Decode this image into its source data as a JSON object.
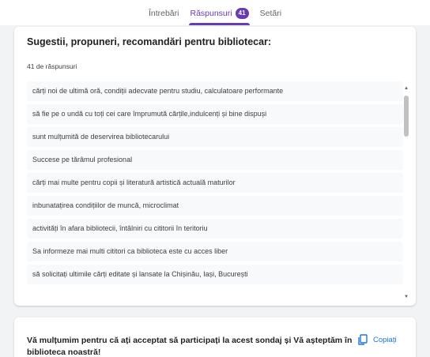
{
  "tabs": [
    {
      "label": "Întrebări"
    },
    {
      "label": "Răspunsuri",
      "badge": "41"
    },
    {
      "label": "Setări"
    }
  ],
  "question": {
    "title": "Sugestii, propuneri, recomandări pentru bibliotecar:",
    "count_label": "41 de răspunsuri",
    "answers": [
      "cărți noi de ultimă oră, condiții adecvate pentru studiu, calculatoare performante",
      "să fie pe o undă cu toți cei care împrumută cărțile,indulcenți și bine dispuși",
      "sunt mulțumită de deservirea bibliotecarului",
      "Succese pe tărâmul profesional",
      "cărți mai multe pentru copii și literatură artistică actuală maturilor",
      "inbunatațirea condițiilor de muncă, microclimat",
      "activități în afara bibliotecii, întâlniri cu cititorii în teritoriu",
      "Sa informeze mai multi cititori ca biblioteca este cu acces liber",
      "să solicitați ultimile cărți editate și lansate la Chișinău, Iași, București"
    ]
  },
  "next_question": {
    "text": "Vă mulțumim pentru că ați acceptat să participați la acest sondaj și Vă așteptăm în biblioteca noastră!",
    "copy_label": "Copiați"
  },
  "colors": {
    "accent": "#673ab7",
    "link": "#1a73e8",
    "background": "#f1f3f4"
  },
  "icons": {
    "scroll_up": "triangle-up-icon",
    "scroll_down": "triangle-down-icon",
    "copy": "copy-icon"
  }
}
